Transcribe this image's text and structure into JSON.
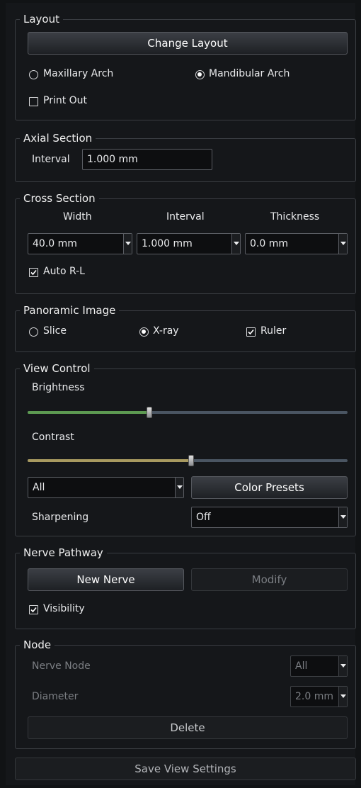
{
  "layout": {
    "title": "Layout",
    "change_layout_label": "Change Layout",
    "maxillary_label": "Maxillary Arch",
    "mandibular_label": "Mandibular Arch",
    "print_out_label": "Print Out",
    "selected_arch": "Mandibular Arch",
    "print_out_checked": false
  },
  "axial": {
    "title": "Axial Section",
    "interval_label": "Interval",
    "interval_value": "1.000 mm"
  },
  "cross": {
    "title": "Cross Section",
    "width_header": "Width",
    "interval_header": "Interval",
    "thickness_header": "Thickness",
    "width_value": "40.0 mm",
    "interval_value": "1.000 mm",
    "thickness_value": "0.0 mm",
    "auto_rl_label": "Auto R-L",
    "auto_rl_checked": true
  },
  "panoramic": {
    "title": "Panoramic Image",
    "slice_label": "Slice",
    "xray_label": "X-ray",
    "ruler_label": "Ruler",
    "selected": "X-ray",
    "ruler_checked": true
  },
  "view_control": {
    "title": "View Control",
    "brightness_label": "Brightness",
    "brightness_level": 0.38,
    "contrast_label": "Contrast",
    "contrast_level": 0.51,
    "channel_value": "All",
    "color_presets_label": "Color Presets",
    "sharpening_label": "Sharpening",
    "sharpening_value": "Off",
    "brightness_color": "#5d9a52",
    "contrast_color": "#a89a60",
    "track_color": "#4a5562"
  },
  "nerve": {
    "title": "Nerve Pathway",
    "new_nerve_label": "New Nerve",
    "modify_label": "Modify",
    "visibility_label": "Visibility",
    "visibility_checked": true
  },
  "node": {
    "title": "Node",
    "nerve_node_label": "Nerve Node",
    "nerve_node_value": "All",
    "diameter_label": "Diameter",
    "diameter_value": "2.0 mm",
    "delete_label": "Delete"
  },
  "footer": {
    "save_label": "Save View Settings"
  }
}
